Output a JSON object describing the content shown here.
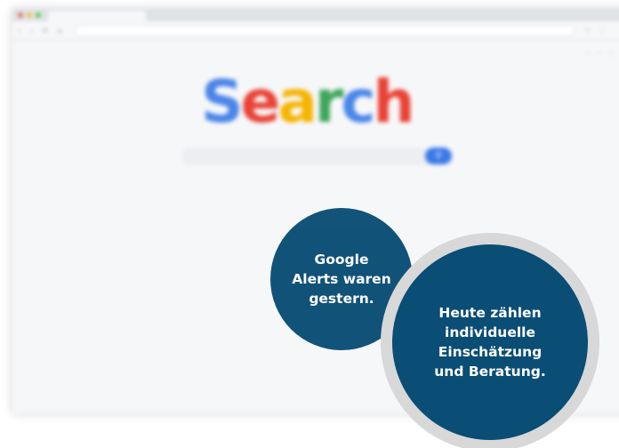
{
  "browser": {
    "nav_icons": "‹ › ⟳ ⌂",
    "toolbar_right_icons": "☆ ⋮",
    "top_links": [
      "···",
      "···",
      "⋮"
    ]
  },
  "search": {
    "logo_letters": [
      {
        "char": "S",
        "color": "#4a86e8"
      },
      {
        "char": "e",
        "color": "#e94235"
      },
      {
        "char": "a",
        "color": "#f6b400"
      },
      {
        "char": "r",
        "color": "#3ea75a"
      },
      {
        "char": "c",
        "color": "#4a86e8"
      },
      {
        "char": "h",
        "color": "#e94235"
      }
    ],
    "button_icon": "search-icon",
    "button_glyph": "⚲"
  },
  "bubbles": {
    "first": {
      "lines": [
        "Google",
        "Alerts waren",
        "gestern."
      ],
      "color": "#0a4d75"
    },
    "second": {
      "lines": [
        "Heute zählen",
        "individuelle",
        "Einschätzung",
        "und Beratung."
      ],
      "color": "#0a4d75",
      "ring_color": "#d8d8d8"
    }
  }
}
